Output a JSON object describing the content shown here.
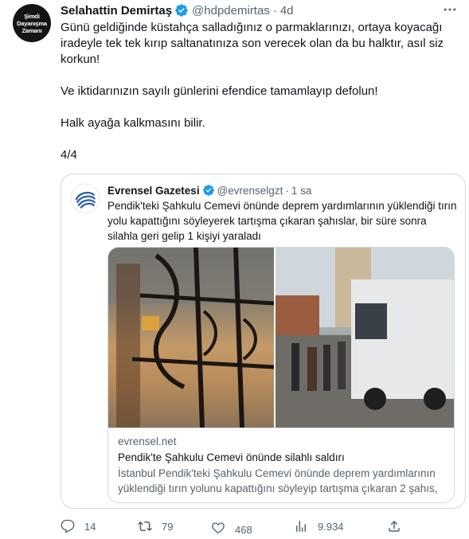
{
  "author": {
    "avatar_lines": [
      "Şimdi",
      "Dayanışma",
      "Zamanı"
    ],
    "name": "Selahattin Demirtaş",
    "handle": "@hdpdemirtas",
    "separator": "·",
    "time": "4d"
  },
  "tweet": {
    "paragraphs": [
      "Günü geldiğinde küstahça salladığınız o parmaklarınızı, ortaya koyacağı iradeyle tek tek kırıp saltanatınıza son verecek olan da bu halktır, asıl siz korkun!",
      "Ve iktidarınızın sayılı günlerini efendice tamamlayıp defolun!",
      "Halk ayağa kalkmasını bilir.",
      "4/4"
    ]
  },
  "quoted": {
    "name": "Evrensel Gazetesi",
    "handle": "@evrenselgzt",
    "separator": "·",
    "time": "1 sa",
    "text": "Pendik'teki Şahkulu Cemevi önünde deprem yardımlarının yüklendiği tırın yolu kapattığını söyleyerek tartışma çıkaran şahıslar, bir süre sonra silahla geri gelip 1 kişiyi yaraladı",
    "card": {
      "domain": "evrensel.net",
      "title": "Pendik'te Şahkulu Cemevi önünde silahlı saldırı",
      "description": "İstanbul Pendik'teki Şahkulu Cemevi önünde deprem yardımlarının yüklendiği tırın yolunu kapattığını söyleyip tartışma çıkaran 2 şahıs, ..."
    }
  },
  "actions": {
    "reply_count": "14",
    "retweet_count": "79",
    "like_count": "468",
    "views_count": "9.934"
  },
  "colors": {
    "verified": "#1d9bf0",
    "text": "#0f1419",
    "secondary": "#536471",
    "border": "#cfd9de"
  }
}
